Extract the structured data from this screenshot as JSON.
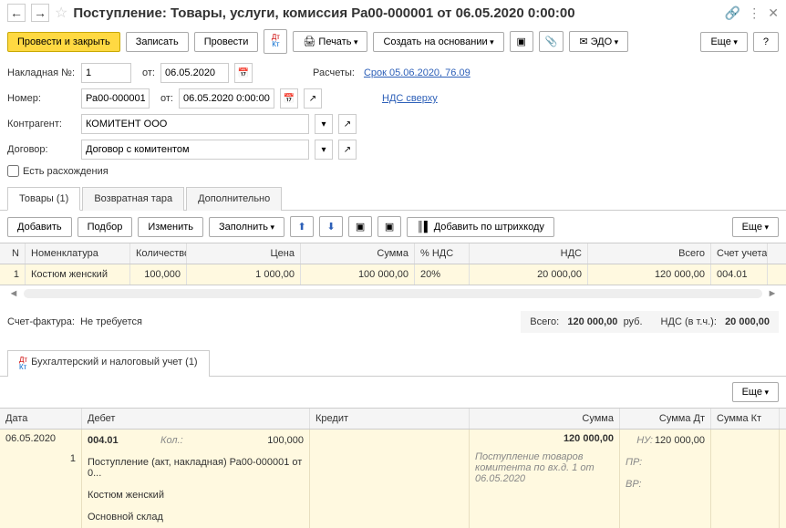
{
  "header": {
    "title": "Поступление: Товары, услуги, комиссия Ра00-000001 от 06.05.2020 0:00:00"
  },
  "toolbar": {
    "save_close": "Провести и закрыть",
    "write": "Записать",
    "post": "Провести",
    "print": "Печать",
    "create_based": "Создать на основании",
    "edo": "ЭДО",
    "more": "Еще",
    "help": "?"
  },
  "form": {
    "invoice_label": "Накладная №:",
    "invoice_num": "1",
    "ot": "от:",
    "invoice_date": "06.05.2020",
    "number_label": "Номер:",
    "number": "Ра00-000001",
    "number_date": "06.05.2020 0:00:00",
    "counterparty_label": "Контрагент:",
    "counterparty": "КОМИТЕНТ ООО",
    "contract_label": "Договор:",
    "contract": "Договор с комитентом",
    "discrepancies": "Есть расхождения",
    "calc_label": "Расчеты:",
    "calc_link": "Срок 05.06.2020, 76.09",
    "vat_link": "НДС сверху"
  },
  "goods_tabs": {
    "goods": "Товары (1)",
    "returnable": "Возвратная тара",
    "additional": "Дополнительно"
  },
  "goods_toolbar": {
    "add": "Добавить",
    "select": "Подбор",
    "change": "Изменить",
    "fill": "Заполнить",
    "barcode": "Добавить по штрихкоду",
    "more": "Еще"
  },
  "grid_head": {
    "n": "N",
    "nom": "Номенклатура",
    "qty": "Количество",
    "price": "Цена",
    "sum": "Сумма",
    "vat": "% НДС",
    "nds": "НДС",
    "total": "Всего",
    "acc": "Счет учета"
  },
  "grid_row": {
    "n": "1",
    "nom": "Костюм женский",
    "qty": "100,000",
    "price": "1 000,00",
    "sum": "100 000,00",
    "vat": "20%",
    "nds": "20 000,00",
    "total": "120 000,00",
    "acc": "004.01"
  },
  "sf": {
    "label": "Счет-фактура:",
    "value": "Не требуется"
  },
  "totals": {
    "total_label": "Всего:",
    "total": "120 000,00",
    "currency": "руб.",
    "vat_label": "НДС (в т.ч.):",
    "vat": "20 000,00"
  },
  "acc_tab": "Бухгалтерский и налоговый учет (1)",
  "acc_more": "Еще",
  "acc_head": {
    "date": "Дата",
    "debit": "Дебет",
    "credit": "Кредит",
    "sum": "Сумма",
    "sumdt": "Сумма Дт",
    "sumkt": "Сумма Кт"
  },
  "acc_row": {
    "date": "06.05.2020",
    "seq": "1",
    "debit_acc": "004.01",
    "qty_label": "Кол.:",
    "qty": "100,000",
    "line2": "Поступление (акт, накладная) Ра00-000001 от 0...",
    "line3": "Костюм женский",
    "line4": "Основной склад",
    "sum": "120 000,00",
    "desc": "Поступление товаров комитента по вх.д. 1 от 06.05.2020",
    "nu": "НУ:",
    "nu_val": "120 000,00",
    "pr": "ПР:",
    "vr": "ВР:"
  }
}
